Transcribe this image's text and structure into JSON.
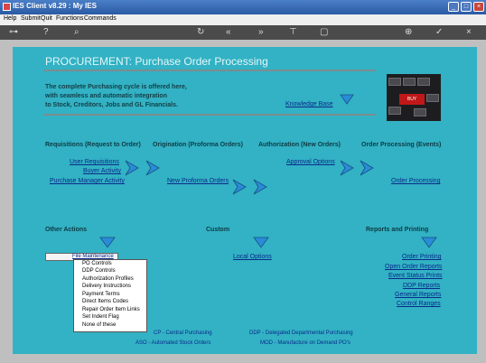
{
  "window": {
    "title": "IES Client v8.29 : My IES"
  },
  "menu": [
    "Help",
    "Submit",
    "Quit",
    "Functions",
    "Commands"
  ],
  "toolbar_icons": [
    "key-icon",
    "help-icon",
    "search-icon",
    "refresh-icon",
    "first-icon",
    "previous-icon",
    "next-icon",
    "last-icon",
    "list-icon",
    "plus-icon",
    "check-icon",
    "close-icon"
  ],
  "page": {
    "title": "PROCUREMENT: Purchase Order Processing",
    "intro": [
      "The complete Purchasing cycle is offered here,",
      "with seamless and automatic integration",
      "to Stock, Creditors, Jobs and GL Financials."
    ],
    "knowledge_base": "Knowledge Base",
    "photo_key_label": "BUY"
  },
  "sections": {
    "requisitions": {
      "title": "Requisitions (Request to Order)",
      "links": [
        "User Requisitions",
        "Buyer Activity",
        "Purchase Manager Activity"
      ]
    },
    "origination": {
      "title": "Origination (Proforma Orders)",
      "links": [
        "New Proforma Orders"
      ]
    },
    "authorization": {
      "title": "Authorization (New Orders)",
      "links": [
        "Approval Options"
      ]
    },
    "order_processing": {
      "title": "Order Processing (Events)",
      "links": [
        "Order Processing"
      ]
    },
    "other_actions": {
      "title": "Other Actions",
      "file_maintenance": "File Maintenance"
    },
    "custom": {
      "title": "Custom",
      "links": [
        "Local Options"
      ]
    },
    "reports": {
      "title": "Reports and Printing",
      "links": [
        "Order Printing",
        "Open Order Reports",
        "Event Status Prints",
        "DDP Reports",
        "General Reports",
        "Control Ranges"
      ]
    }
  },
  "popup_menu": [
    "PO Controls",
    "DDP Controls",
    "Authorization Profiles",
    "Delivery Instructions",
    "Payment Terms",
    "Direct Items Codes",
    "Repair Order Item Links",
    "Set Indent Flag",
    "None of these"
  ],
  "legend": [
    "CP  - Central Purchasing",
    "DDP - Delegated Departmental Purchasing",
    "ASO - Automated Stock Orders",
    "MOD - Manufacture on Demand PO's"
  ],
  "colors": {
    "content_bg": "#32b2c4",
    "link": "#0b2a8a",
    "arrow": "#2a8cd8"
  }
}
